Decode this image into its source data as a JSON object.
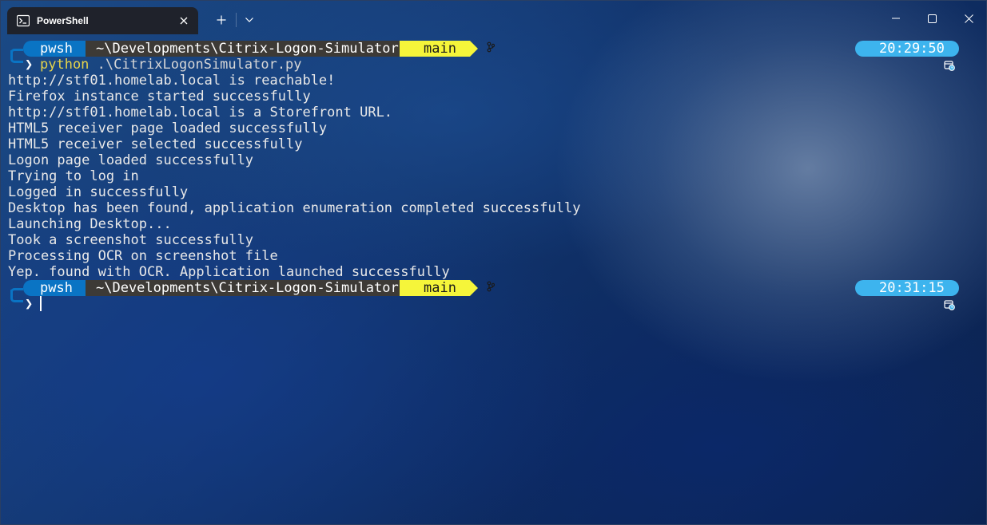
{
  "window": {
    "tab_title": "PowerShell",
    "new_tab_label": "+",
    "dropdown_label": "⌄"
  },
  "prompts": [
    {
      "shell": "pwsh",
      "path": "~\\Developments\\Citrix-Logon-Simulator",
      "branch": "main",
      "time": "20:29:50",
      "chevron": "❯",
      "command_name": "python",
      "command_args": " .\\CitrixLogonSimulator.py"
    },
    {
      "shell": "pwsh",
      "path": "~\\Developments\\Citrix-Logon-Simulator",
      "branch": "main",
      "time": "20:31:15",
      "chevron": "❯"
    }
  ],
  "output_lines": [
    "http://stf01.homelab.local is reachable!",
    "Firefox instance started successfully",
    "http://stf01.homelab.local is a Storefront URL.",
    "HTML5 receiver page loaded successfully",
    "HTML5 receiver selected successfully",
    "Logon page loaded successfully",
    "Trying to log in",
    "Logged in successfully",
    "Desktop has been found, application enumeration completed successfully",
    "Launching Desktop...",
    "Took a screenshot successfully",
    "Processing OCR on screenshot file",
    "Yep. found with OCR. Application launched successfully"
  ],
  "colors": {
    "pwsh_segment": "#0a74c4",
    "path_segment": "#3d3a36",
    "branch_segment": "#f5f53a",
    "time_segment": "#3db4ee",
    "command_name": "#e6d44a"
  },
  "icons": {
    "tab_icon": "powershell-icon",
    "branch": "git-branch-icon",
    "time": "clock-icon"
  }
}
